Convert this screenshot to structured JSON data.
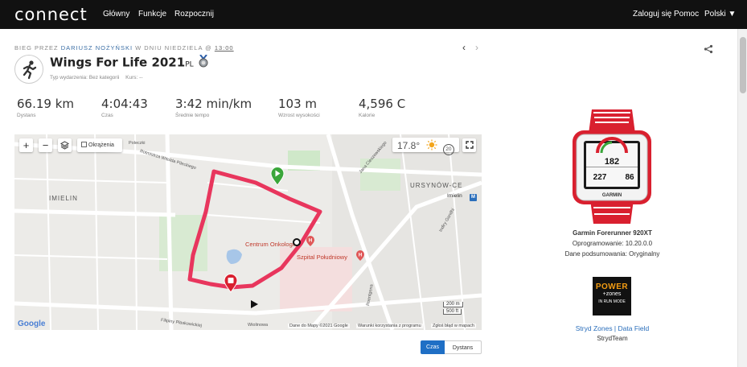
{
  "header": {
    "logo": "connect",
    "nav": [
      "Główny",
      "Funkcje",
      "Rozpocznij"
    ],
    "login": "Zaloguj się",
    "help": "Pomoc",
    "lang": "Polski ▼"
  },
  "activity": {
    "crumb_prefix": "BIEG PRZEZ ",
    "crumb_user": "DARIUSZ NOŻYŃSKI",
    "crumb_mid": " W DNIU NIEDZIELA @ ",
    "crumb_time": "13:00",
    "title": "Wings For Life 2021",
    "title_suffix": "PL",
    "type": "Typ wydarzenia: Bez kategorii",
    "course": "Kurs: --"
  },
  "stats": [
    {
      "value": "66.19 km",
      "label": "Dystans"
    },
    {
      "value": "4:04:43",
      "label": "Czas"
    },
    {
      "value": "3:42 min/km",
      "label": "Średnie tempo"
    },
    {
      "value": "103 m",
      "label": "Wzrost wysokości"
    },
    {
      "value": "4,596 C",
      "label": "Kalorie"
    }
  ],
  "map": {
    "zoom_in": "+",
    "zoom_out": "−",
    "laps_label": "Okrążenia",
    "temperature": "17.8°",
    "wind": "20",
    "labels": {
      "imielin": "IMIELIN",
      "ursynow": "URSYNÓW-CE",
      "imielin_metro": "Imielin",
      "centrum": "Centrum Onkologii",
      "szpital": "Szpital Południowy",
      "street_pilecki": "Rotmistrza Witolda Pileckiego",
      "street_poleczki": "Poleczki",
      "street_jana": "Jana Cieszewskiego",
      "street_filipiny": "Filipiny Płaskowickiej",
      "street_indiry": "Indiry Gandhi",
      "street_wiolinowa": "Wiolinowa",
      "street_roentgena": "Roentgena"
    },
    "scale_m": "200 m",
    "scale_ft": "500 ft",
    "google": "Google",
    "data_attr": "Dane do Mapy ©2021 Google",
    "terms": "Warunki korzystania z programu",
    "report": "Zgłoś błąd w mapach"
  },
  "toggle": {
    "time": "Czas",
    "distance": "Dystans"
  },
  "device": {
    "watch_top": "182",
    "watch_left": "227",
    "watch_right": "86",
    "watch_brand": "GARMIN",
    "name": "Garmin Forerunner 920XT",
    "firmware": "Oprogramowanie: 10.20.0.0",
    "summary": "Dane podsumowania: Oryginalny"
  },
  "stryd": {
    "logo_top": "POWER",
    "logo_mid": "+zones",
    "logo_bottom": "IN RUN MODE",
    "link": "Stryd Zones | Data Field",
    "team": "StrydTeam"
  },
  "colors": {
    "route": "#e8365d",
    "active": "#1f6fc5",
    "watch_red": "#d9202f"
  }
}
